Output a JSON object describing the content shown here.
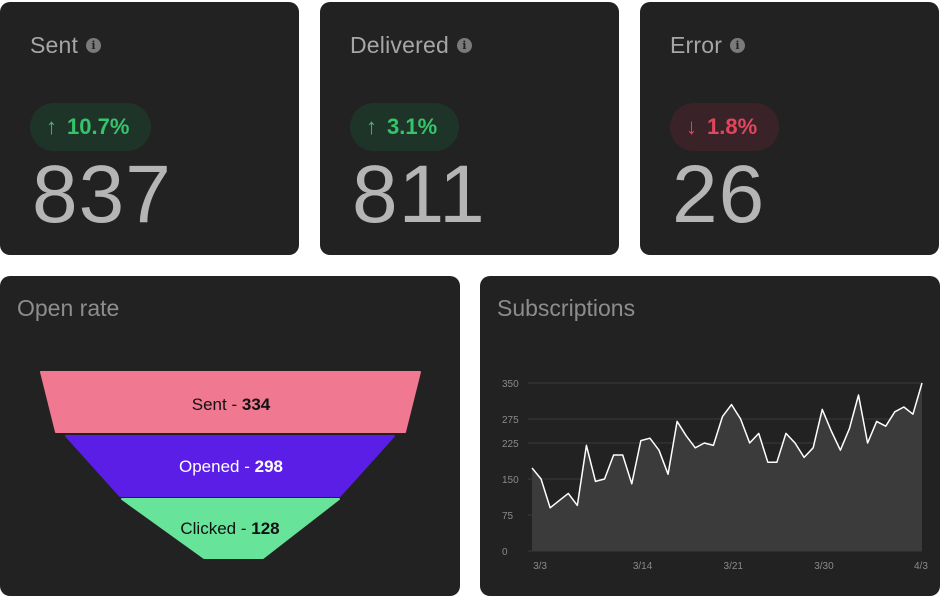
{
  "stats": [
    {
      "title": "Sent",
      "change": "10.7%",
      "direction": "up",
      "value": "837"
    },
    {
      "title": "Delivered",
      "change": "3.1%",
      "direction": "up",
      "value": "811"
    },
    {
      "title": "Error",
      "change": "1.8%",
      "direction": "down",
      "value": "26"
    }
  ],
  "icons": {
    "info": "info-icon",
    "up": "arrow-up-icon",
    "down": "arrow-down-icon"
  },
  "open_rate": {
    "title": "Open rate",
    "funnel": [
      {
        "label": "Sent",
        "value": "334",
        "color": "#f07890",
        "text_color": "#111111"
      },
      {
        "label": "Opened",
        "value": "298",
        "color": "#5b1ee6",
        "text_color": "#ffffff"
      },
      {
        "label": "Clicked",
        "value": "128",
        "color": "#68e39a",
        "text_color": "#111111"
      }
    ]
  },
  "subscriptions": {
    "title": "Subscriptions"
  },
  "chart_data": {
    "type": "area",
    "title": "Subscriptions",
    "x_ticks": [
      "3/3",
      "3/14",
      "3/21",
      "3/30",
      "4/3"
    ],
    "x_tick_indices": [
      1,
      12,
      22,
      32,
      43
    ],
    "y_ticks": [
      "0",
      "75",
      "150",
      "225",
      "275",
      "350"
    ],
    "ylim": [
      0,
      350
    ],
    "grid": true,
    "series": [
      {
        "values": [
          173,
          150,
          90,
          105,
          120,
          95,
          220,
          145,
          150,
          200,
          200,
          140,
          230,
          235,
          210,
          160,
          270,
          240,
          215,
          225,
          220,
          280,
          305,
          275,
          225,
          245,
          185,
          185,
          245,
          225,
          195,
          215,
          295,
          250,
          210,
          255,
          325,
          225,
          270,
          260,
          290,
          300,
          285,
          350
        ],
        "color": "#ffffff"
      }
    ]
  }
}
